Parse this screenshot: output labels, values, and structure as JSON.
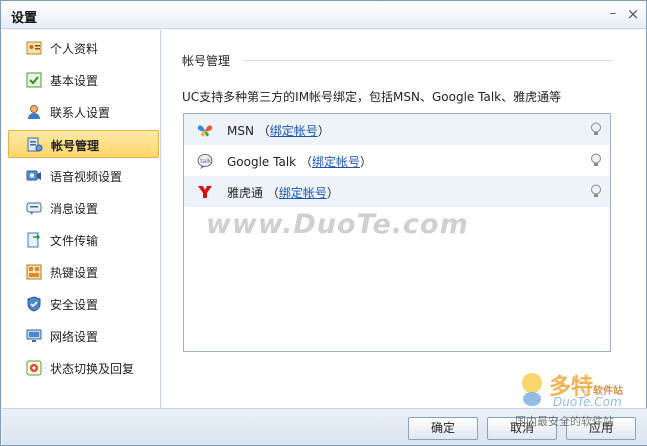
{
  "window": {
    "title": "设置",
    "minimize_glyph": "–",
    "close_glyph": "×"
  },
  "sidebar": {
    "items": [
      {
        "label": "个人资料",
        "icon": "profile-card-icon"
      },
      {
        "label": "基本设置",
        "icon": "basic-settings-icon"
      },
      {
        "label": "联系人设置",
        "icon": "contact-person-icon"
      },
      {
        "label": "帐号管理",
        "icon": "account-manage-icon",
        "active": true
      },
      {
        "label": "语音视频设置",
        "icon": "voice-video-icon"
      },
      {
        "label": "消息设置",
        "icon": "message-icon"
      },
      {
        "label": "文件传输",
        "icon": "file-transfer-icon"
      },
      {
        "label": "热键设置",
        "icon": "hotkey-icon"
      },
      {
        "label": "安全设置",
        "icon": "shield-icon"
      },
      {
        "label": "网络设置",
        "icon": "network-icon"
      },
      {
        "label": "状态切换及回复",
        "icon": "status-reply-icon"
      }
    ]
  },
  "main": {
    "section_title": "帐号管理",
    "description": "UC支持多种第三方的IM帐号绑定，包括MSN、Google Talk、雅虎通等",
    "accounts": [
      {
        "name": "MSN",
        "link": "绑定帐号",
        "icon": "msn-butterfly-icon"
      },
      {
        "name": "Google Talk",
        "link": "绑定帐号",
        "icon": "google-talk-icon"
      },
      {
        "name": "雅虎通",
        "link": "绑定帐号",
        "icon": "yahoo-y-icon"
      }
    ],
    "paren_open": "（",
    "paren_close": "）"
  },
  "footer": {
    "ok": "确定",
    "cancel": "取消",
    "apply": "应用"
  },
  "watermark": {
    "text": "www.DuoTe.com"
  },
  "logo_watermark": {
    "cn": "多特",
    "cn_small": "软件站",
    "en": "DuoTe.Com",
    "tag": "国内最安全的软件站"
  },
  "colors": {
    "accent": "#ffd66b",
    "link": "#1a56b0",
    "border": "#7f9db9"
  }
}
